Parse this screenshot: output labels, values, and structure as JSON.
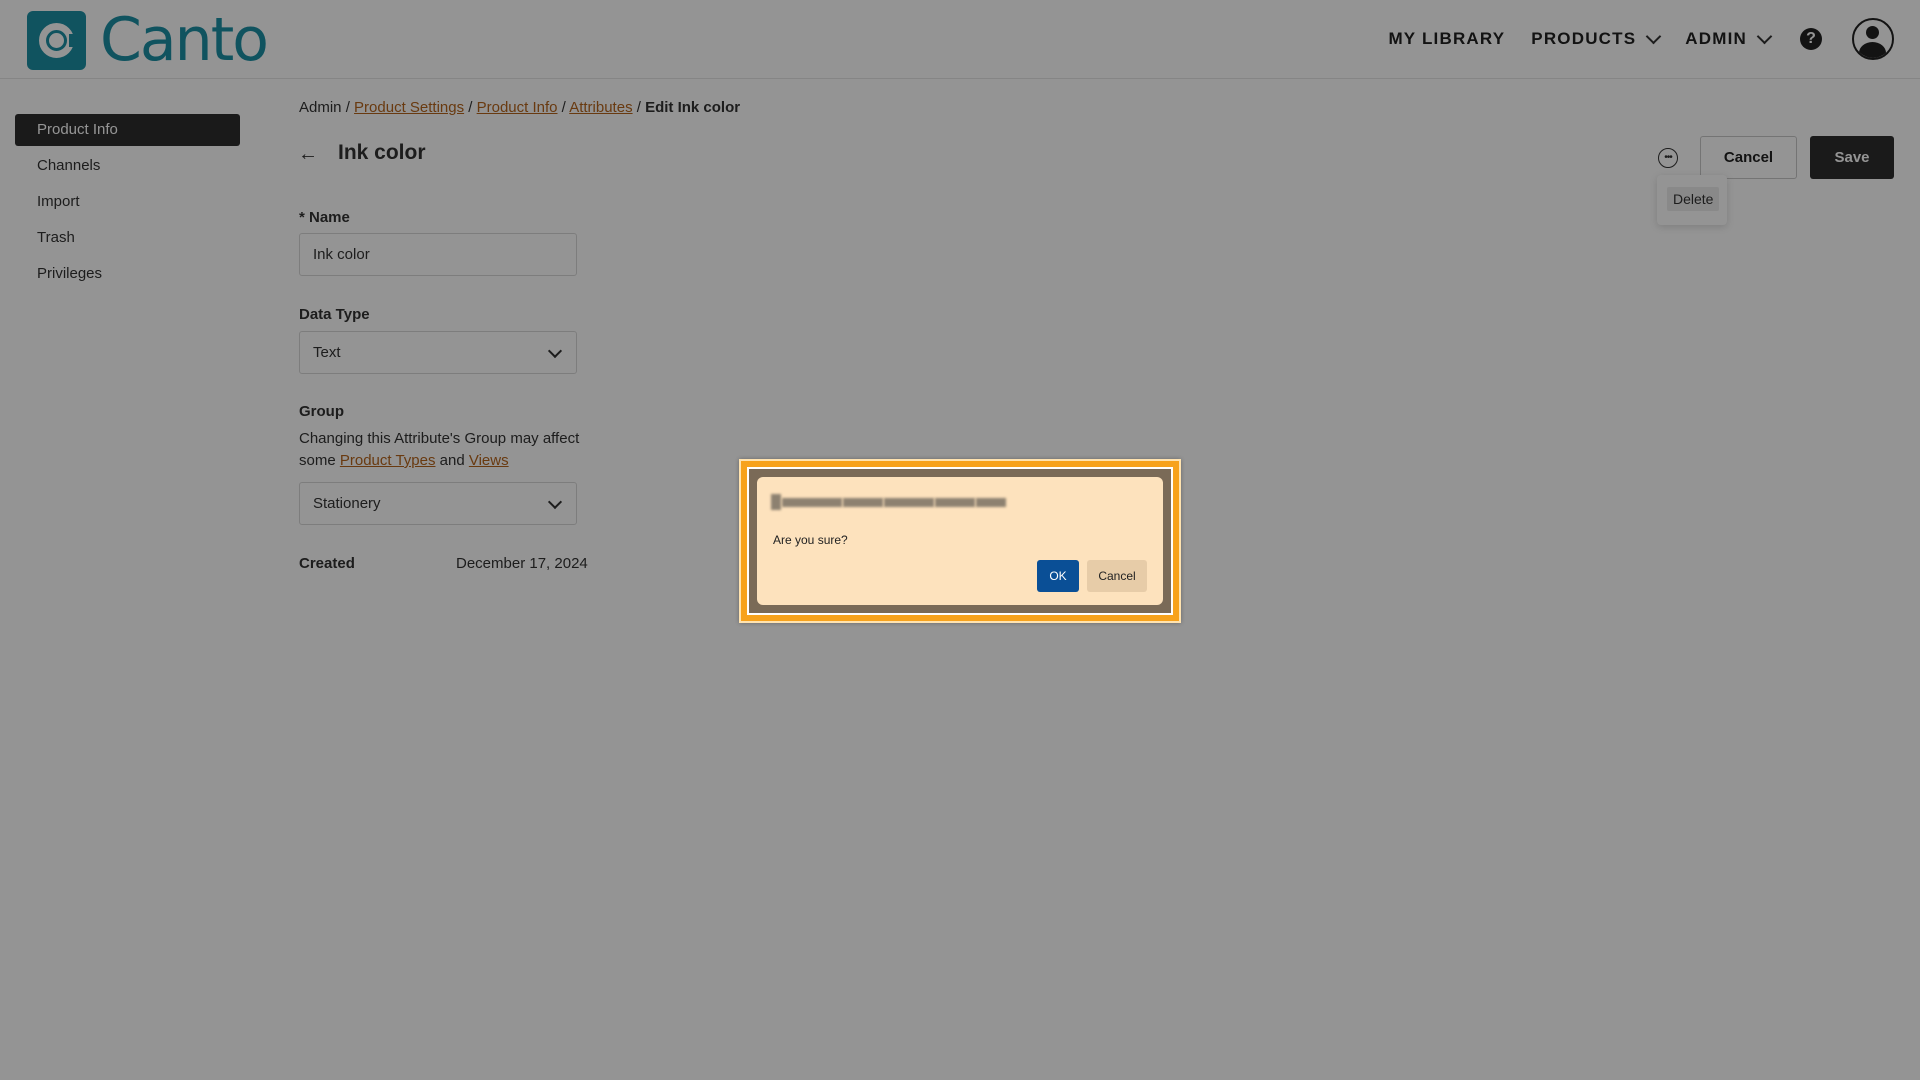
{
  "header": {
    "logo_text": "Canto",
    "nav": {
      "my_library": "MY LIBRARY",
      "products": "PRODUCTS",
      "admin": "ADMIN",
      "help_glyph": "?"
    }
  },
  "sidebar": {
    "items": [
      {
        "label": "Product Info",
        "active": true
      },
      {
        "label": "Channels",
        "active": false
      },
      {
        "label": "Import",
        "active": false
      },
      {
        "label": "Trash",
        "active": false
      },
      {
        "label": "Privileges",
        "active": false
      }
    ]
  },
  "breadcrumb": {
    "root": "Admin",
    "sep": " / ",
    "product_settings": "Product Settings",
    "product_info": "Product Info",
    "attributes": "Attributes",
    "current": "Edit Ink color"
  },
  "page": {
    "title": "Ink color",
    "cancel_label": "Cancel",
    "save_label": "Save",
    "more_menu": {
      "delete_label": "Delete"
    }
  },
  "form": {
    "name_label": "* Name",
    "name_value": "Ink color",
    "data_type_label": "Data Type",
    "data_type_value": "Text",
    "group_label": "Group",
    "group_help_prefix": "Changing this Attribute's Group may affect some ",
    "group_help_link1": "Product Types",
    "group_help_and": " and ",
    "group_help_link2": "Views",
    "group_value": "Stationery",
    "created_label": "Created",
    "created_value": "December 17, 2024"
  },
  "dialog": {
    "message": "Are you sure?",
    "ok_label": "OK",
    "cancel_label": "Cancel"
  },
  "colors": {
    "brand": "#1d8fa4",
    "link": "#b5651d",
    "primary_button": "#2e2e2e",
    "dialog_ok": "#0a4f96",
    "dialog_frame": "#f7a21c"
  }
}
